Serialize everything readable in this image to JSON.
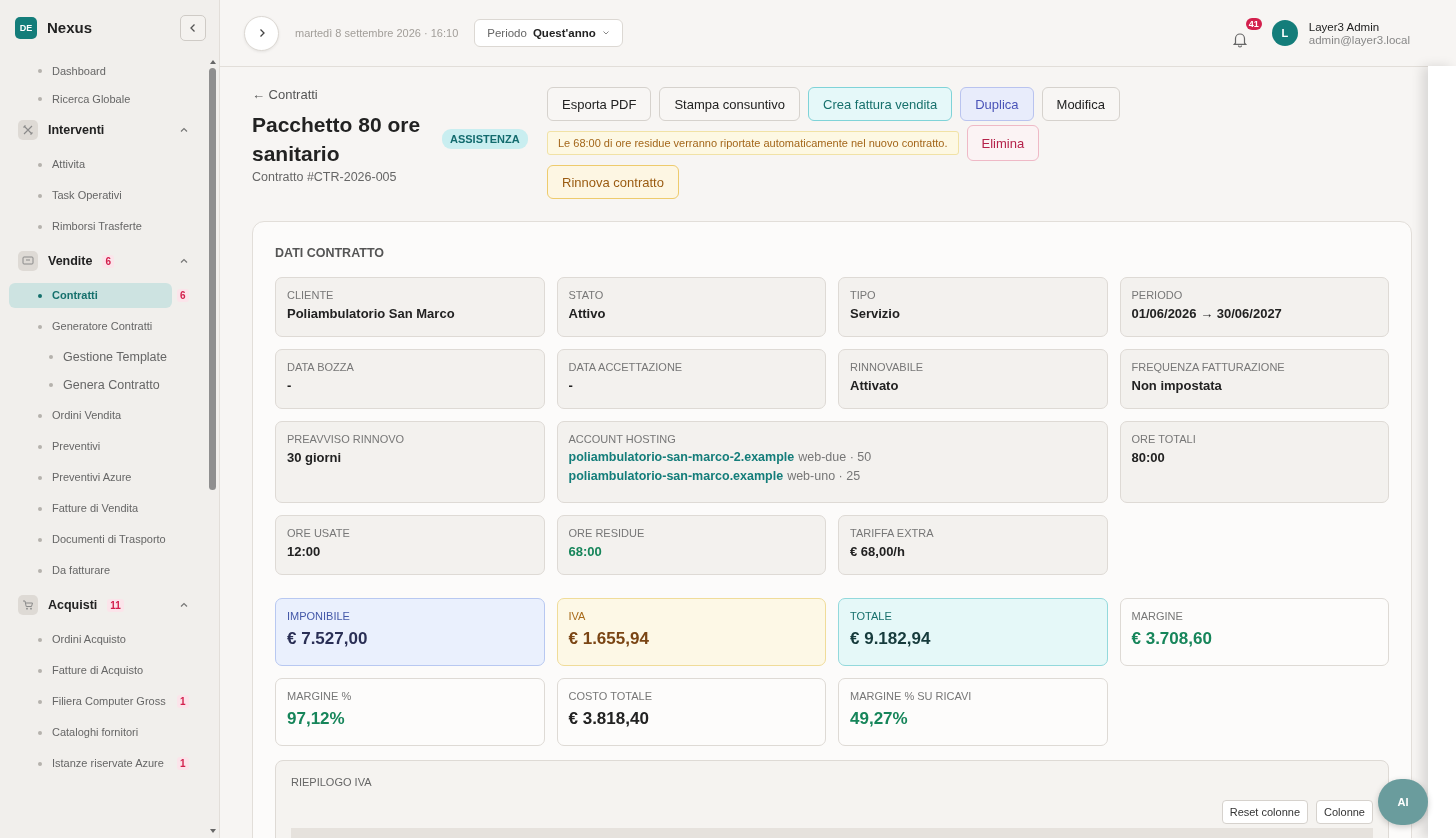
{
  "sidebar": {
    "logo": "DE",
    "brand": "Nexus",
    "links": [
      {
        "label": "Dashboard",
        "selected": false
      },
      {
        "label": "Ricerca Globale",
        "selected": false
      }
    ],
    "sections": [
      {
        "label": "Interventi",
        "expanded": true,
        "items": [
          {
            "label": "Attivita",
            "selected": false
          },
          {
            "label": "Task Operativi",
            "selected": false
          },
          {
            "label": "Rimborsi Trasferte",
            "selected": false
          }
        ]
      },
      {
        "label": "Vendite",
        "badge": "6",
        "expanded": true,
        "items": [
          {
            "label": "Contratti",
            "selected": true,
            "badge": "6"
          },
          {
            "label": "Generatore Contratti",
            "selected": false,
            "children": [
              {
                "label": "Gestione Template",
                "selected": false
              },
              {
                "label": "Genera Contratto",
                "selected": false
              }
            ]
          },
          {
            "label": "Ordini Vendita",
            "selected": false
          },
          {
            "label": "Preventivi",
            "selected": false
          },
          {
            "label": "Preventivi Azure",
            "selected": false
          },
          {
            "label": "Fatture di Vendita",
            "selected": false
          },
          {
            "label": "Documenti di Trasporto",
            "selected": false
          },
          {
            "label": "Da fatturare",
            "selected": false
          }
        ]
      },
      {
        "label": "Acquisti",
        "badge": "11",
        "expanded": true,
        "items": [
          {
            "label": "Ordini Acquisto",
            "selected": false
          },
          {
            "label": "Fatture di Acquisto",
            "selected": false
          },
          {
            "label": "Filiera Computer Gross",
            "selected": false,
            "badge": "1"
          },
          {
            "label": "Cataloghi fornitori",
            "selected": false
          },
          {
            "label": "Istanze riservate Azure",
            "selected": false,
            "badge": "1"
          }
        ]
      }
    ]
  },
  "topbar": {
    "date": "martedì 8 settembre 2026 · 16:10",
    "period_label": "Periodo",
    "period_value": "Quest'anno",
    "notifications": "41",
    "avatar": "L",
    "user_name": "Layer3 Admin",
    "user_email": "admin@layer3.local"
  },
  "header": {
    "back": "← Contratti",
    "title": "Pacchetto 80 ore sanitario",
    "tag": "ASSISTENZA",
    "subtitle": "Contratto #CTR-2026-005",
    "action_rows": [
      [
        {
          "kind": "default",
          "label": "Esporta PDF"
        },
        {
          "kind": "default",
          "label": "Stampa consuntivo"
        },
        {
          "kind": "primary",
          "label": "Crea fattura vendita"
        },
        {
          "kind": "secondary",
          "label": "Duplica"
        },
        {
          "kind": "default",
          "label": "Modifica"
        }
      ],
      [
        {
          "kind": "notice",
          "label": "Le 68:00 di ore residue verranno riportate automaticamente nel nuovo contratto."
        },
        {
          "kind": "danger",
          "label": "Elimina"
        }
      ],
      [
        {
          "kind": "warning",
          "label": "Rinnova contratto"
        }
      ]
    ]
  },
  "details": {
    "title": "DATI CONTRATTO",
    "fields": [
      {
        "kind": "text",
        "label": "CLIENTE",
        "value": "Poliambulatorio San Marco"
      },
      {
        "kind": "text",
        "label": "STATO",
        "value": "Attivo"
      },
      {
        "kind": "text",
        "label": "TIPO",
        "value": "Servizio"
      },
      {
        "kind": "text",
        "label": "PERIODO",
        "value": "01/06/2026 → 30/06/2027"
      },
      {
        "kind": "text",
        "label": "DATA BOZZA",
        "value": "-"
      },
      {
        "kind": "text",
        "label": "DATA ACCETTAZIONE",
        "value": "-"
      },
      {
        "kind": "text",
        "label": "RINNOVABILE",
        "value": "Attivato"
      },
      {
        "kind": "text",
        "label": "FREQUENZA FATTURAZIONE",
        "value": "Non impostata"
      },
      {
        "kind": "text",
        "label": "PREAVVISO RINNOVO",
        "value": "30 giorni"
      },
      {
        "kind": "hosting",
        "label": "ACCOUNT HOSTING",
        "accounts": [
          {
            "domain": "poliambulatorio-san-marco-2.example",
            "detail": "web-due · 50"
          },
          {
            "domain": "poliambulatorio-san-marco.example",
            "detail": "web-uno · 25"
          }
        ]
      },
      {
        "kind": "text",
        "label": "ORE TOTALI",
        "value": "80:00"
      },
      {
        "kind": "text",
        "label": "ORE USATE",
        "value": "12:00"
      },
      {
        "kind": "positive",
        "label": "ORE RESIDUE",
        "value": "68:00"
      },
      {
        "kind": "text",
        "label": "TARIFFA EXTRA",
        "value": "€ 68,00/h"
      }
    ],
    "totals": [
      [
        {
          "kind": "info",
          "label": "IMPONIBILE",
          "value": "€ 7.527,00"
        },
        {
          "kind": "warning",
          "label": "IVA",
          "value": "€ 1.655,94"
        },
        {
          "kind": "primary",
          "label": "TOTALE",
          "value": "€ 9.182,94"
        },
        {
          "kind": "positive",
          "label": "MARGINE",
          "value": "€ 3.708,60"
        }
      ],
      [
        {
          "kind": "positive",
          "label": "MARGINE %",
          "value": "97,12%"
        },
        {
          "kind": "default",
          "label": "COSTO TOTALE",
          "value": "€ 3.818,40"
        },
        {
          "kind": "positive",
          "label": "MARGINE % SU RICAVI",
          "value": "49,27%"
        }
      ]
    ],
    "vat_summary": {
      "title": "RIEPILOGO IVA",
      "buttons": [
        "Reset colonne",
        "Colonne"
      ]
    }
  },
  "assistant": "AI"
}
